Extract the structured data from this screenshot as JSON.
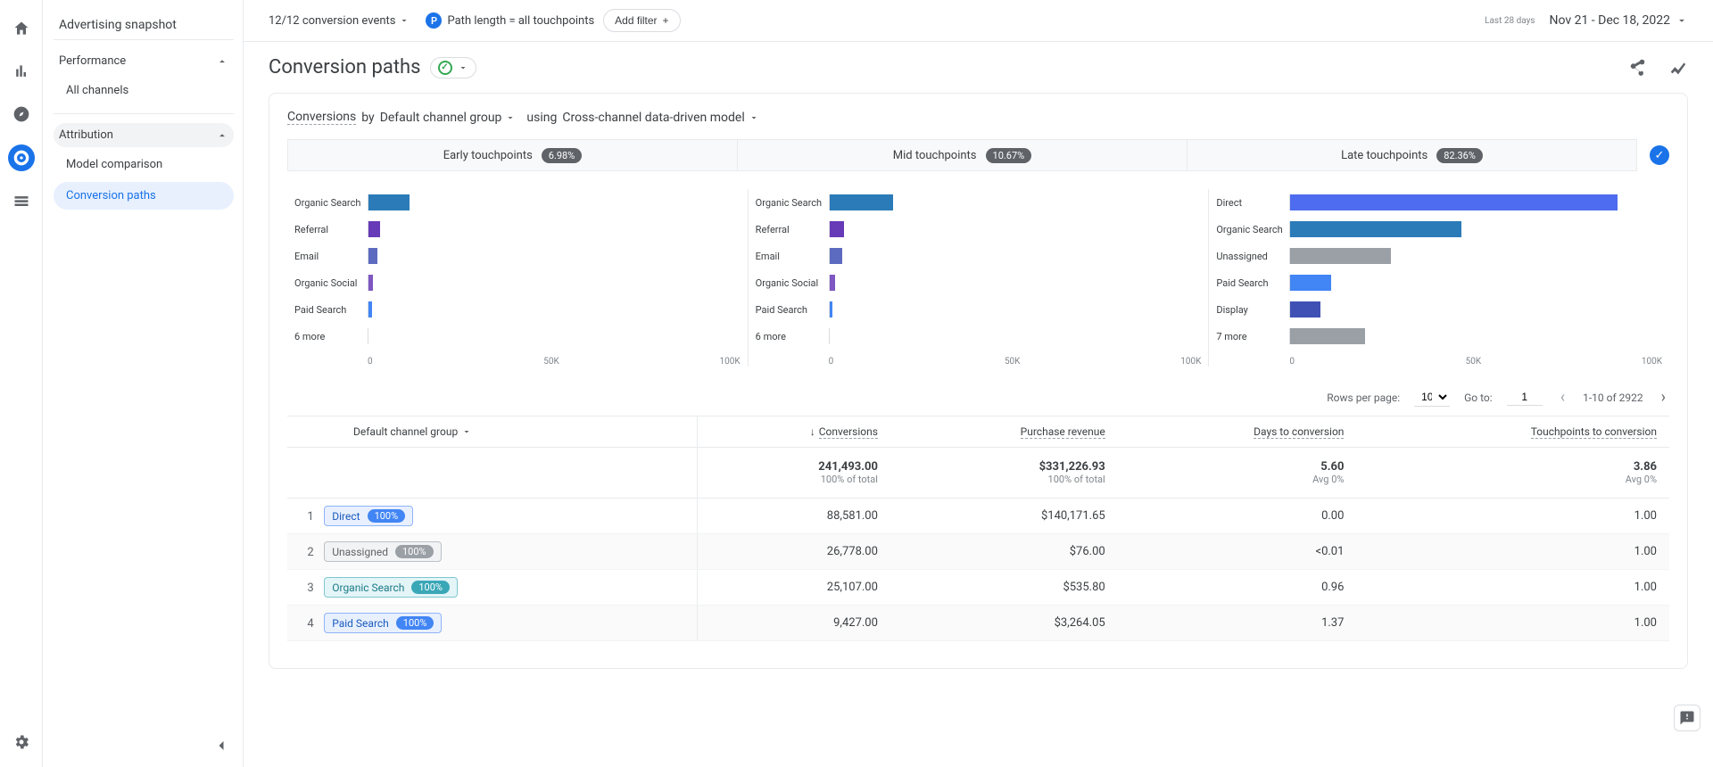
{
  "rail": {
    "icons": [
      "home",
      "reports",
      "explore",
      "advertising",
      "configure"
    ],
    "bottom": "settings"
  },
  "sidenav": {
    "title": "Advertising snapshot",
    "sections": [
      {
        "head": "Performance",
        "items": [
          "All channels"
        ]
      },
      {
        "head": "Attribution",
        "items": [
          "Model comparison",
          "Conversion paths"
        ],
        "selected": "Conversion paths"
      }
    ]
  },
  "topbar": {
    "conv_events": "12/12 conversion events",
    "path_length": "Path length = all touchpoints",
    "add_filter": "Add filter",
    "date_label": "Last 28 days",
    "date_range": "Nov 21 - Dec 18, 2022"
  },
  "page_title": "Conversion paths",
  "card": {
    "conv_label": "Conversions",
    "by_text": "by",
    "group_label": "Default channel group",
    "using_text": "using",
    "model_label": "Cross-channel data-driven model"
  },
  "touchpoints": [
    {
      "label": "Early touchpoints",
      "pct": "6.98%"
    },
    {
      "label": "Mid touchpoints",
      "pct": "10.67%"
    },
    {
      "label": "Late touchpoints",
      "pct": "82.36%"
    }
  ],
  "chart_data": [
    {
      "type": "bar",
      "title": "Early touchpoints",
      "xlim": [
        0,
        100000
      ],
      "xticks": [
        "0",
        "50K",
        "100K"
      ],
      "series": [
        {
          "name": "Organic Search",
          "value": 11000,
          "color": "#2b7bb9"
        },
        {
          "name": "Referral",
          "value": 3000,
          "color": "#673ab7"
        },
        {
          "name": "Email",
          "value": 2300,
          "color": "#5c6bc0"
        },
        {
          "name": "Organic Social",
          "value": 1200,
          "color": "#7e57c2"
        },
        {
          "name": "Paid Search",
          "value": 1000,
          "color": "#4285f4"
        },
        {
          "name": "6 more",
          "value": 0,
          "color": "#9aa0a6"
        }
      ]
    },
    {
      "type": "bar",
      "title": "Mid touchpoints",
      "xlim": [
        0,
        100000
      ],
      "xticks": [
        "0",
        "50K",
        "100K"
      ],
      "series": [
        {
          "name": "Organic Search",
          "value": 17000,
          "color": "#2b7bb9"
        },
        {
          "name": "Referral",
          "value": 3800,
          "color": "#673ab7"
        },
        {
          "name": "Email",
          "value": 3500,
          "color": "#5c6bc0"
        },
        {
          "name": "Organic Social",
          "value": 1600,
          "color": "#7e57c2"
        },
        {
          "name": "Paid Search",
          "value": 800,
          "color": "#4285f4"
        },
        {
          "name": "6 more",
          "value": 0,
          "color": "#9aa0a6"
        }
      ]
    },
    {
      "type": "bar",
      "title": "Late touchpoints",
      "xlim": [
        0,
        100000
      ],
      "xticks": [
        "0",
        "50K",
        "100K"
      ],
      "series": [
        {
          "name": "Direct",
          "value": 88000,
          "color": "#4e6cef"
        },
        {
          "name": "Organic Search",
          "value": 46000,
          "color": "#2b7bb9"
        },
        {
          "name": "Unassigned",
          "value": 27000,
          "color": "#9aa0a6"
        },
        {
          "name": "Paid Search",
          "value": 11000,
          "color": "#4285f4"
        },
        {
          "name": "Display",
          "value": 8000,
          "color": "#3f51b5"
        },
        {
          "name": "7 more",
          "value": 20000,
          "color": "#9aa0a6"
        }
      ]
    }
  ],
  "table": {
    "rows_label": "Rows per page:",
    "rows_value": "10",
    "goto_label": "Go to:",
    "goto_value": "1",
    "range_text": "1-10 of 2922",
    "col_group": "Default channel group",
    "cols": [
      "Conversions",
      "Purchase revenue",
      "Days to conversion",
      "Touchpoints to conversion"
    ],
    "totals": {
      "conv": "241,493.00",
      "conv_sub": "100% of total",
      "rev": "$331,226.93",
      "rev_sub": "100% of total",
      "days": "5.60",
      "days_sub": "Avg 0%",
      "tp": "3.86",
      "tp_sub": "Avg 0%"
    },
    "rows": [
      {
        "n": "1",
        "chip": "Direct",
        "cls": "chip-direct",
        "pct": "100%",
        "conv": "88,581.00",
        "rev": "$140,171.65",
        "days": "0.00",
        "tp": "1.00"
      },
      {
        "n": "2",
        "chip": "Unassigned",
        "cls": "chip-unassigned",
        "pct": "100%",
        "conv": "26,778.00",
        "rev": "$76.00",
        "days": "<0.01",
        "tp": "1.00"
      },
      {
        "n": "3",
        "chip": "Organic Search",
        "cls": "chip-organic",
        "pct": "100%",
        "conv": "25,107.00",
        "rev": "$535.80",
        "days": "0.96",
        "tp": "1.00"
      },
      {
        "n": "4",
        "chip": "Paid Search",
        "cls": "chip-paid",
        "pct": "100%",
        "conv": "9,427.00",
        "rev": "$3,264.05",
        "days": "1.37",
        "tp": "1.00"
      }
    ]
  }
}
